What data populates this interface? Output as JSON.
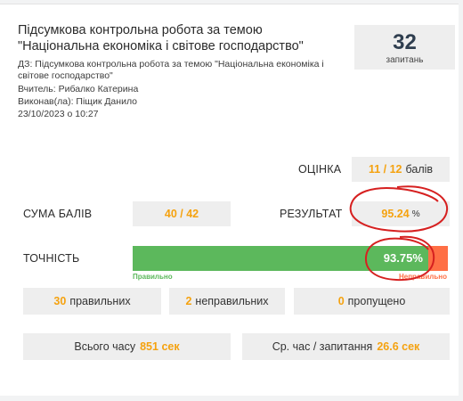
{
  "header": {
    "title": "Підсумкова контрольна робота за темою \"Національна економіка і світове господарство\"",
    "homework": "ДЗ: Підсумкова контрольна робота за темою \"Національна економіка і світове господарство\"",
    "teacher": "Вчитель: Рибалко Катерина",
    "student": "Виконав(ла): Піщик Данило",
    "datetime": "23/10/2023 о 10:27"
  },
  "questions": {
    "count": "32",
    "label": "запитань"
  },
  "grade": {
    "label": "ОЦІНКА",
    "value": "11 / 12",
    "unit": "балів"
  },
  "score": {
    "label": "СУМА БАЛІВ",
    "value": "40 / 42"
  },
  "result": {
    "label": "РЕЗУЛЬТАТ",
    "value": "95.24",
    "unit": "%"
  },
  "accuracy": {
    "label": "ТОЧНІСТЬ",
    "value_text": "93.75%",
    "fraction": 0.9375,
    "correct_caption": "Правильно",
    "incorrect_caption": "Неправильно"
  },
  "stats": {
    "correct_count": "30",
    "correct_label": "правильних",
    "wrong_count": "2",
    "wrong_label": "неправильних",
    "skipped_count": "0",
    "skipped_label": "пропущено"
  },
  "time": {
    "total_label": "Всього часу",
    "total_value": "851 сек",
    "avg_label": "Ср. час / запитання",
    "avg_value": "26.6 сек"
  },
  "colors": {
    "accent": "#f5a20f",
    "correct": "#5cb85c",
    "incorrect": "#ff6f45",
    "annotation": "#d62020"
  }
}
